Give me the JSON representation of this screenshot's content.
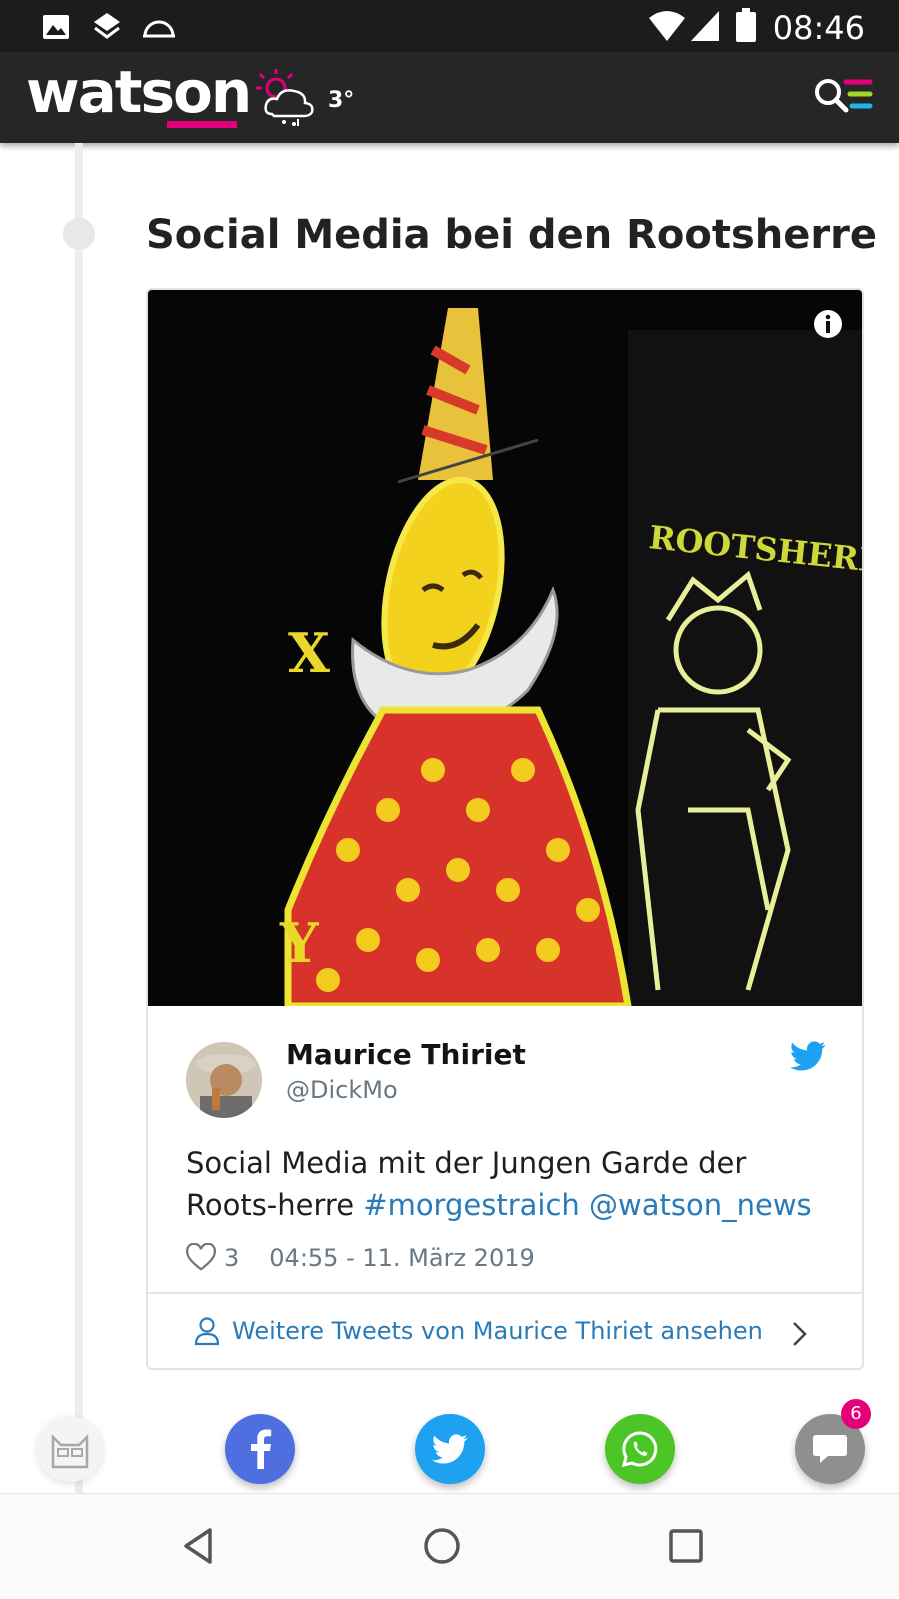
{
  "status_bar": {
    "time": "08:46",
    "left_icons": [
      "image-icon",
      "layers-icon",
      "cast-icon"
    ],
    "right_icons": [
      "wifi-icon",
      "signal-icon",
      "battery-icon"
    ]
  },
  "header": {
    "logo": "watson",
    "temperature": "3°",
    "weather_icon": "sun-cloud-snow-icon",
    "accent_colors": [
      "#e4007c",
      "#a3d62b",
      "#22b4e6"
    ]
  },
  "section": {
    "heading": "Social Media bei den Rootsherre"
  },
  "tweet": {
    "author_name": "Maurice Thiriet",
    "author_handle": "@DickMo",
    "text_plain": "Social Media mit der Jungen Garde der Roots-herre",
    "hashtag": "#morgestraich",
    "mention": "@watson_news",
    "likes": "3",
    "timestamp": "04:55 - 11. März 2019",
    "more_link": "Weitere Tweets von Maurice Thiriet ansehen",
    "photo_labels": {
      "left_letter_top": "X",
      "left_letter_bottom": "Y",
      "banner": "ROOTSHERRE"
    }
  },
  "share_bar": {
    "comments_badge": "6",
    "buttons": [
      "watson-cat-icon",
      "facebook-icon",
      "twitter-icon",
      "whatsapp-icon",
      "comments-icon"
    ]
  },
  "nav_bar": {
    "buttons": [
      "back-icon",
      "home-icon",
      "recents-icon"
    ]
  }
}
